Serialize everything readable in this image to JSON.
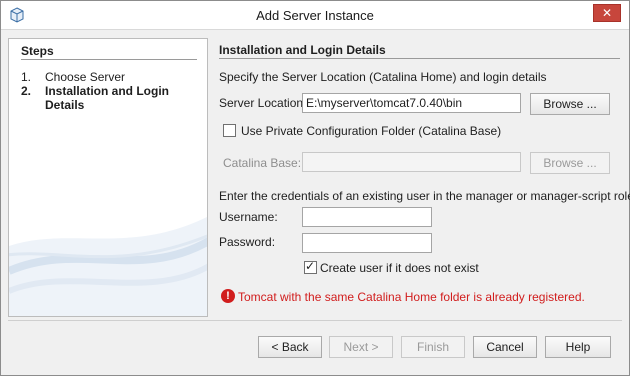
{
  "window": {
    "title": "Add Server Instance",
    "close_glyph": "✕",
    "icon": "netbeans-cube-icon"
  },
  "steps": {
    "heading": "Steps",
    "items": [
      {
        "num": "1.",
        "label": "Choose Server"
      },
      {
        "num": "2.",
        "label": "Installation and Login Details"
      }
    ]
  },
  "panel": {
    "heading": "Installation and Login Details",
    "intro": "Specify the Server Location (Catalina Home) and login details",
    "server_location": {
      "label": "Server Location:",
      "value": "E:\\myserver\\tomcat7.0.40\\bin",
      "browse": "Browse ..."
    },
    "private_config": {
      "label": "Use Private Configuration Folder (Catalina Base)",
      "checked": false
    },
    "catalina_base": {
      "label": "Catalina Base:",
      "value": "",
      "browse": "Browse ..."
    },
    "credentials_intro": "Enter the credentials of an existing user in the manager or manager-script role",
    "username": {
      "label": "Username:",
      "value": ""
    },
    "password": {
      "label": "Password:",
      "value": ""
    },
    "create_user": {
      "label": "Create user if it does not exist",
      "checked": true
    },
    "error": "Tomcat with the same Catalina Home folder is already registered.",
    "error_color": "#d11d1d"
  },
  "buttons": {
    "back": "< Back",
    "next": "Next >",
    "finish": "Finish",
    "cancel": "Cancel",
    "help": "Help"
  }
}
